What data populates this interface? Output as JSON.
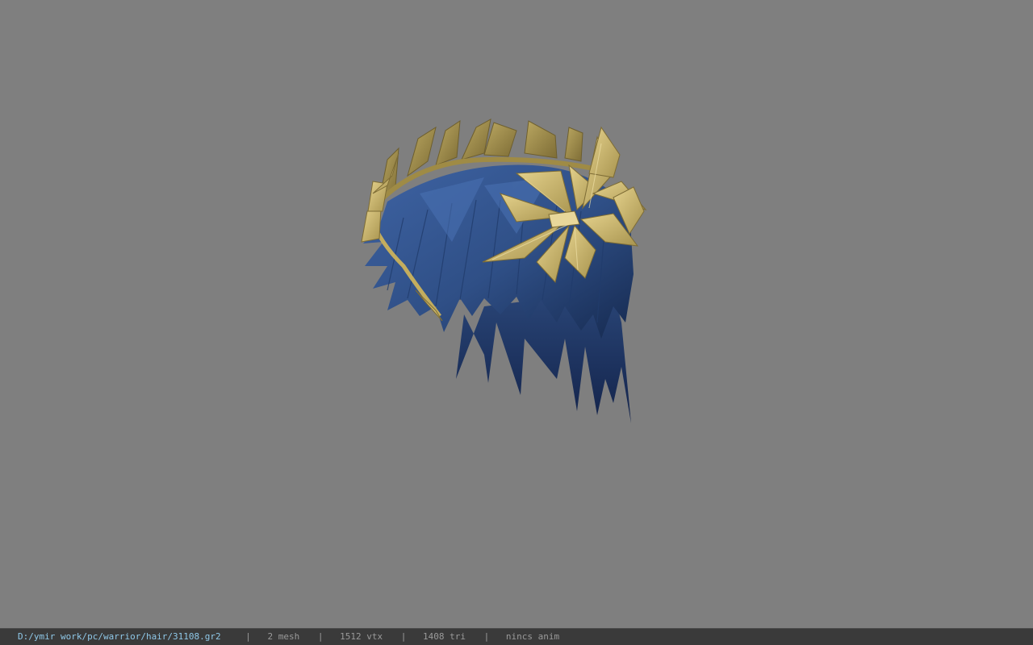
{
  "viewer": {
    "background_color": "#7f7f7f",
    "model_colors": {
      "hair": "#2f4f86",
      "hair_dark": "#1a2f57",
      "laurel": "#c8b46a",
      "laurel_dark": "#8f7c3c"
    }
  },
  "status": {
    "file_path": "D:/ymir work/pc/warrior/hair/31108.gr2",
    "separator": "|",
    "mesh": "2 mesh",
    "vtx": "1512 vtx",
    "tri": "1408 tri",
    "anim": "nincs anim"
  }
}
